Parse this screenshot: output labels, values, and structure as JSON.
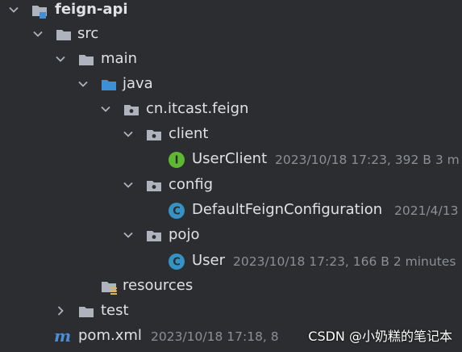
{
  "tree": {
    "root_label": "feign-api",
    "src_label": "src",
    "main_label": "main",
    "java_label": "java",
    "package_label": "cn.itcast.feign",
    "client_label": "client",
    "userclient_label": "UserClient",
    "userclient_meta": "2023/10/18 17:23, 392 B 3 m",
    "config_label": "config",
    "defaultfeign_label": "DefaultFeignConfiguration",
    "defaultfeign_meta": "2021/4/13",
    "pojo_label": "pojo",
    "user_label": "User",
    "user_meta": "2023/10/18 17:23, 166 B 2 minutes",
    "resources_label": "resources",
    "test_label": "test",
    "pom_label": "pom.xml",
    "pom_meta": "2023/10/18 17:18, 8"
  },
  "watermark": "CSDN @小奶糕的笔记本",
  "colors": {
    "background": "#2b2d30",
    "text": "#dfe1e5",
    "meta_text": "#8c8f94",
    "folder": "#aeb3bd",
    "source_folder": "#3d8fd6",
    "interface_icon": "#5fb832",
    "class_icon": "#3592c4"
  }
}
